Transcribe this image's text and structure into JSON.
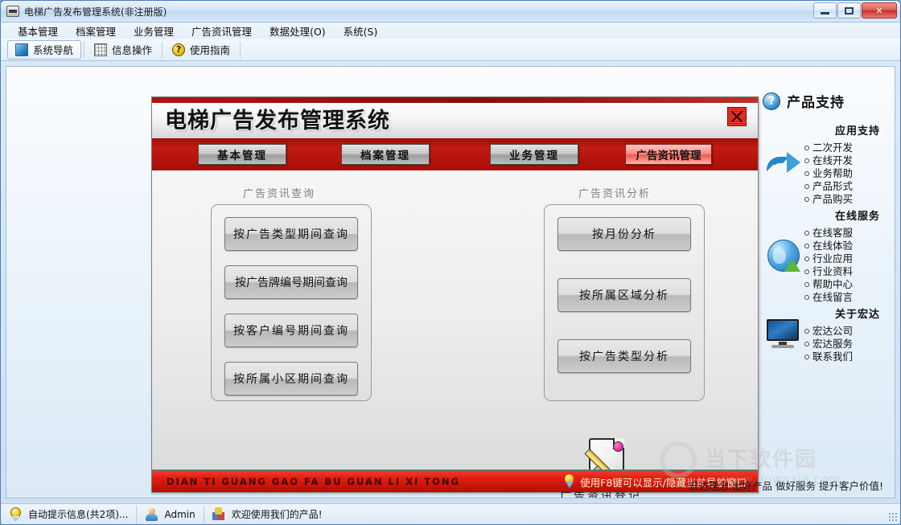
{
  "window": {
    "title": "电梯广告发布管理系统(非注册版)",
    "icon": "application-icon",
    "controls": {
      "minimize": "minimize",
      "maximize": "maximize",
      "close": "close"
    }
  },
  "menubar": {
    "items": [
      {
        "label": "基本管理"
      },
      {
        "label": "档案管理"
      },
      {
        "label": "业务管理"
      },
      {
        "label": "广告资讯管理"
      },
      {
        "label": "数据处理(O)"
      },
      {
        "label": "系统(S)"
      }
    ]
  },
  "toolbar": {
    "items": [
      {
        "label": "系统导航",
        "icon": "navigation-icon",
        "active": true
      },
      {
        "label": "信息操作",
        "icon": "grid-icon",
        "active": false
      },
      {
        "label": "使用指南",
        "icon": "question-mark-icon",
        "active": false
      }
    ]
  },
  "nav_panel": {
    "title": "电梯广告发布管理系统",
    "close_label": "×",
    "tabs": [
      {
        "label": "基本管理",
        "active": false
      },
      {
        "label": "档案管理",
        "active": false
      },
      {
        "label": "业务管理",
        "active": false
      },
      {
        "label": "广告资讯管理",
        "active": true
      }
    ],
    "left_group": {
      "label": "广告资讯查询",
      "buttons": [
        {
          "label": "按广告类型期间查询"
        },
        {
          "label": "按广告牌编号期间查询"
        },
        {
          "label": "按客户编号期间查询"
        },
        {
          "label": "按所属小区期间查询"
        }
      ]
    },
    "center": {
      "icon": "document-pencil-icon",
      "label": "广告资讯登记"
    },
    "right_group": {
      "label": "广告资讯分析",
      "buttons": [
        {
          "label": "按月份分析"
        },
        {
          "label": "按所属区域分析"
        },
        {
          "label": "按广告类型分析"
        }
      ]
    },
    "footer": {
      "pinyin": "DIAN TI GUANG GAO FA BU GUAN LI XI TONG",
      "hint_icon": "pin-icon",
      "hint": "使用F8键可以显示/隐藏当前导航窗口"
    }
  },
  "sidebar": {
    "header": {
      "icon": "question-circle-icon",
      "title": "产品支持"
    },
    "sections": [
      {
        "title": "应用支持",
        "icon": "blue-arrow-icon",
        "links": [
          {
            "label": "二次开发"
          },
          {
            "label": "在线开发"
          },
          {
            "label": "业务帮助"
          },
          {
            "label": "产品形式"
          },
          {
            "label": "产品购买"
          }
        ]
      },
      {
        "title": "在线服务",
        "icon": "globe-arrow-icon",
        "links": [
          {
            "label": "在线客服"
          },
          {
            "label": "在线体验"
          },
          {
            "label": "行业应用"
          },
          {
            "label": "行业资料"
          },
          {
            "label": "帮助中心"
          },
          {
            "label": "在线留言"
          }
        ]
      },
      {
        "title": "关于宏达",
        "icon": "monitor-icon",
        "links": [
          {
            "label": "宏达公司"
          },
          {
            "label": "宏达服务"
          },
          {
            "label": "联系我们"
          }
        ]
      }
    ]
  },
  "slogan": "宏达理念:出好产品  做好服务  提升客户价值!",
  "watermark": {
    "name": "当下软件园",
    "url": "www.downxia.com"
  },
  "statusbar": {
    "cells": [
      {
        "icon": "bulb-icon",
        "label": "自动提示信息(共2项)..."
      },
      {
        "icon": "user-icon",
        "label": "Admin"
      },
      {
        "icon": "cubes-icon",
        "label": "欢迎使用我们的产品!"
      }
    ]
  },
  "colors": {
    "brand_red": "#b2130d",
    "tab_active": "#ef5b50",
    "panel_bg": "#ededed",
    "window_blue": "#dce9f7"
  }
}
